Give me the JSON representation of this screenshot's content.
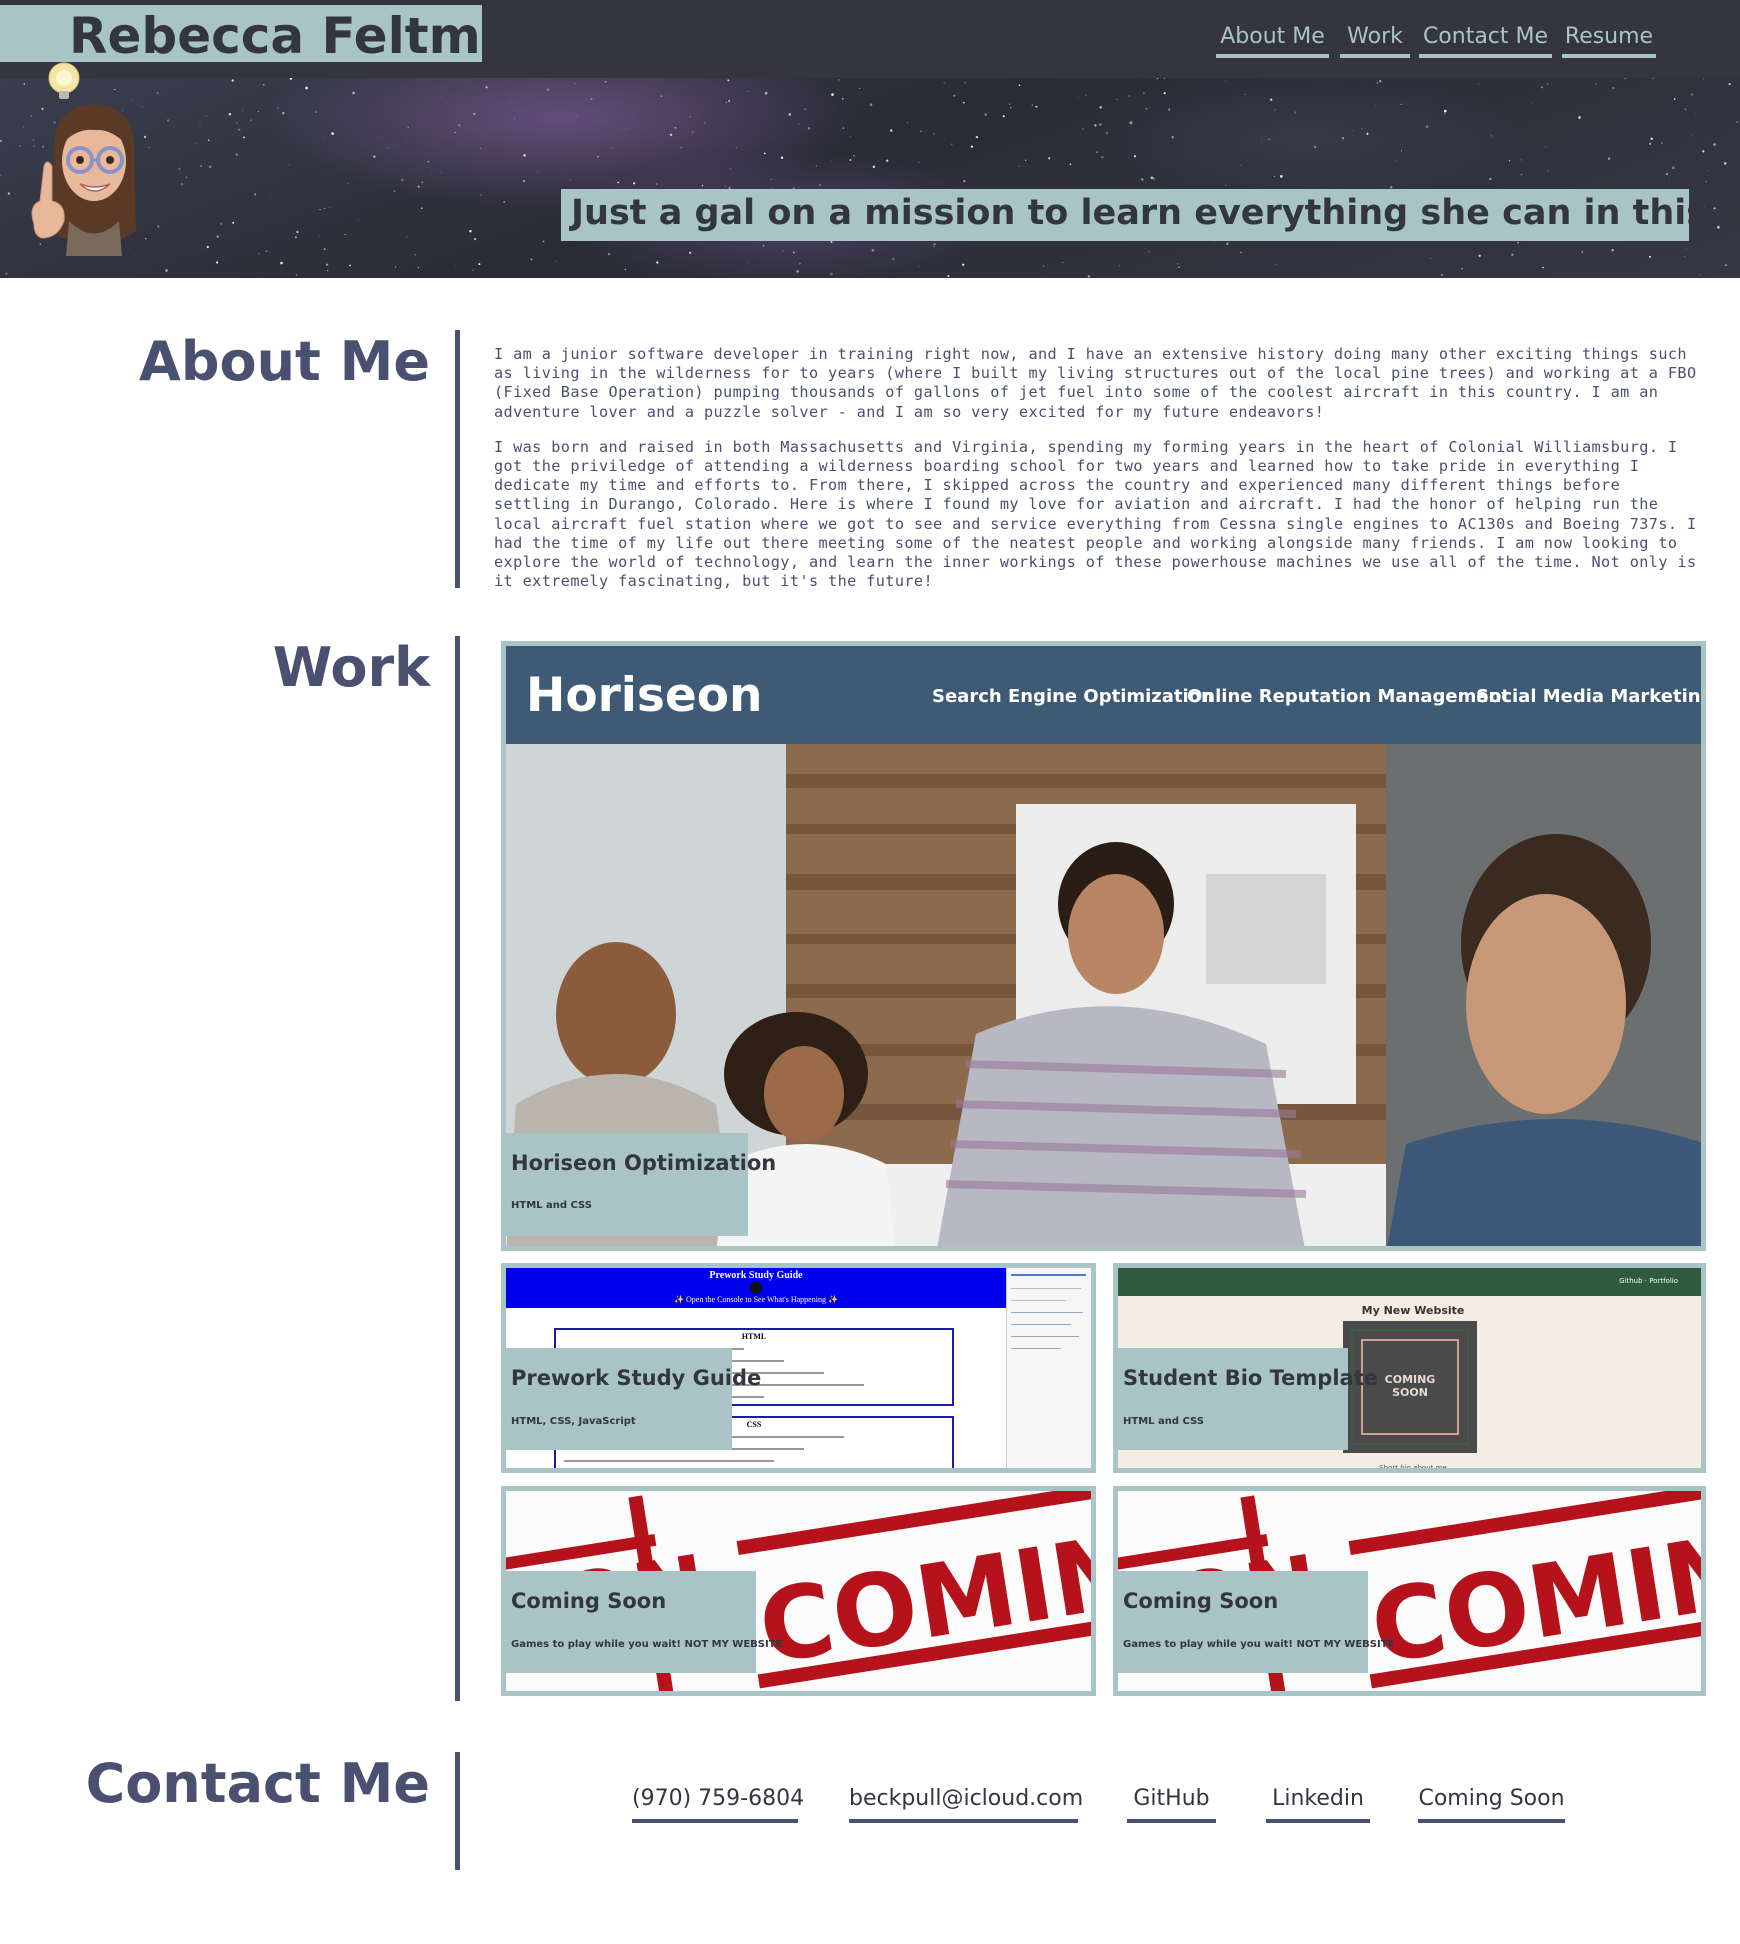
{
  "header": {
    "name": "Rebecca Feltman",
    "tagline": "Just a gal on a mission to learn everything she can in this lifetime",
    "nav": [
      "About Me",
      "Work",
      "Contact Me",
      "Resume"
    ]
  },
  "about": {
    "title": "About Me",
    "paragraphs": [
      "I am a junior software developer in training right now, and I have an extensive history doing many other exciting things such as living in the wilderness for to years (where I built my living structures out of the local pine trees) and working at a FBO (Fixed Base Operation) pumping thousands of gallons of jet fuel into some of the coolest aircraft in this country. I am an adventure lover and a puzzle solver - and I am so very excited for my future endeavors!",
      "I was born and raised in both Massachusetts and Virginia, spending my forming years in the heart of Colonial Williamsburg. I got the priviledge of attending a wilderness boarding school for two years and learned how to take pride in everything I dedicate my time and efforts to. From there, I skipped across the country and experienced many different things before settling in Durango, Colorado. Here is where I found my love for aviation and aircraft. I had the honor of helping run the local aircraft fuel station where we got to see and service everything from Cessna single engines to AC130s and Boeing 737s. I had the time of my life out there meeting some of the neatest people and working alongside many friends. I am now looking to explore the world of technology, and learn the inner workings of these powerhouse machines we use all of the time. Not only is it extremely fascinating, but it's the future!"
    ]
  },
  "work": {
    "title": "Work",
    "projects": [
      {
        "title": "Horiseon Optimization",
        "tech": "HTML and CSS",
        "preview": {
          "logo": "Horiseon",
          "nav": [
            "Search Engine Optimization",
            "Online Reputation Management",
            "Social Media Marketing"
          ]
        }
      },
      {
        "title": "Prework Study Guide",
        "tech": "HTML, CSS, JavaScript",
        "preview": {
          "heading": "Prework Study Guide",
          "subheading": "✨ Open the Console to See What's Happening ✨",
          "section1": "HTML",
          "section2": "CSS"
        }
      },
      {
        "title": "Student Bio Template",
        "tech": "HTML and CSS",
        "preview": {
          "nav": "Github · Portfolio",
          "heading": "My New Website",
          "badge_line1": "COMING",
          "badge_line2": "SOON",
          "footer": "Short bio about me"
        }
      },
      {
        "title": "Coming Soon",
        "tech": "Games to play while you wait! NOT MY WEBSITE",
        "preview": {
          "stamp": "COMING S",
          "stamp_left": "OON"
        }
      },
      {
        "title": "Coming Soon",
        "tech": "Games to play while you wait! NOT MY WEBSITE",
        "preview": {
          "stamp": "COMING S",
          "stamp_left": "OON"
        }
      }
    ]
  },
  "contact": {
    "title": "Contact Me",
    "links": [
      "(970) 759-6804",
      "beckpull@icloud.com",
      "GitHub",
      "Linkedin",
      "Coming Soon"
    ]
  },
  "colors": {
    "accent": "#a8c4c7",
    "text": "#4a5070",
    "header_bg": "#34353f"
  }
}
